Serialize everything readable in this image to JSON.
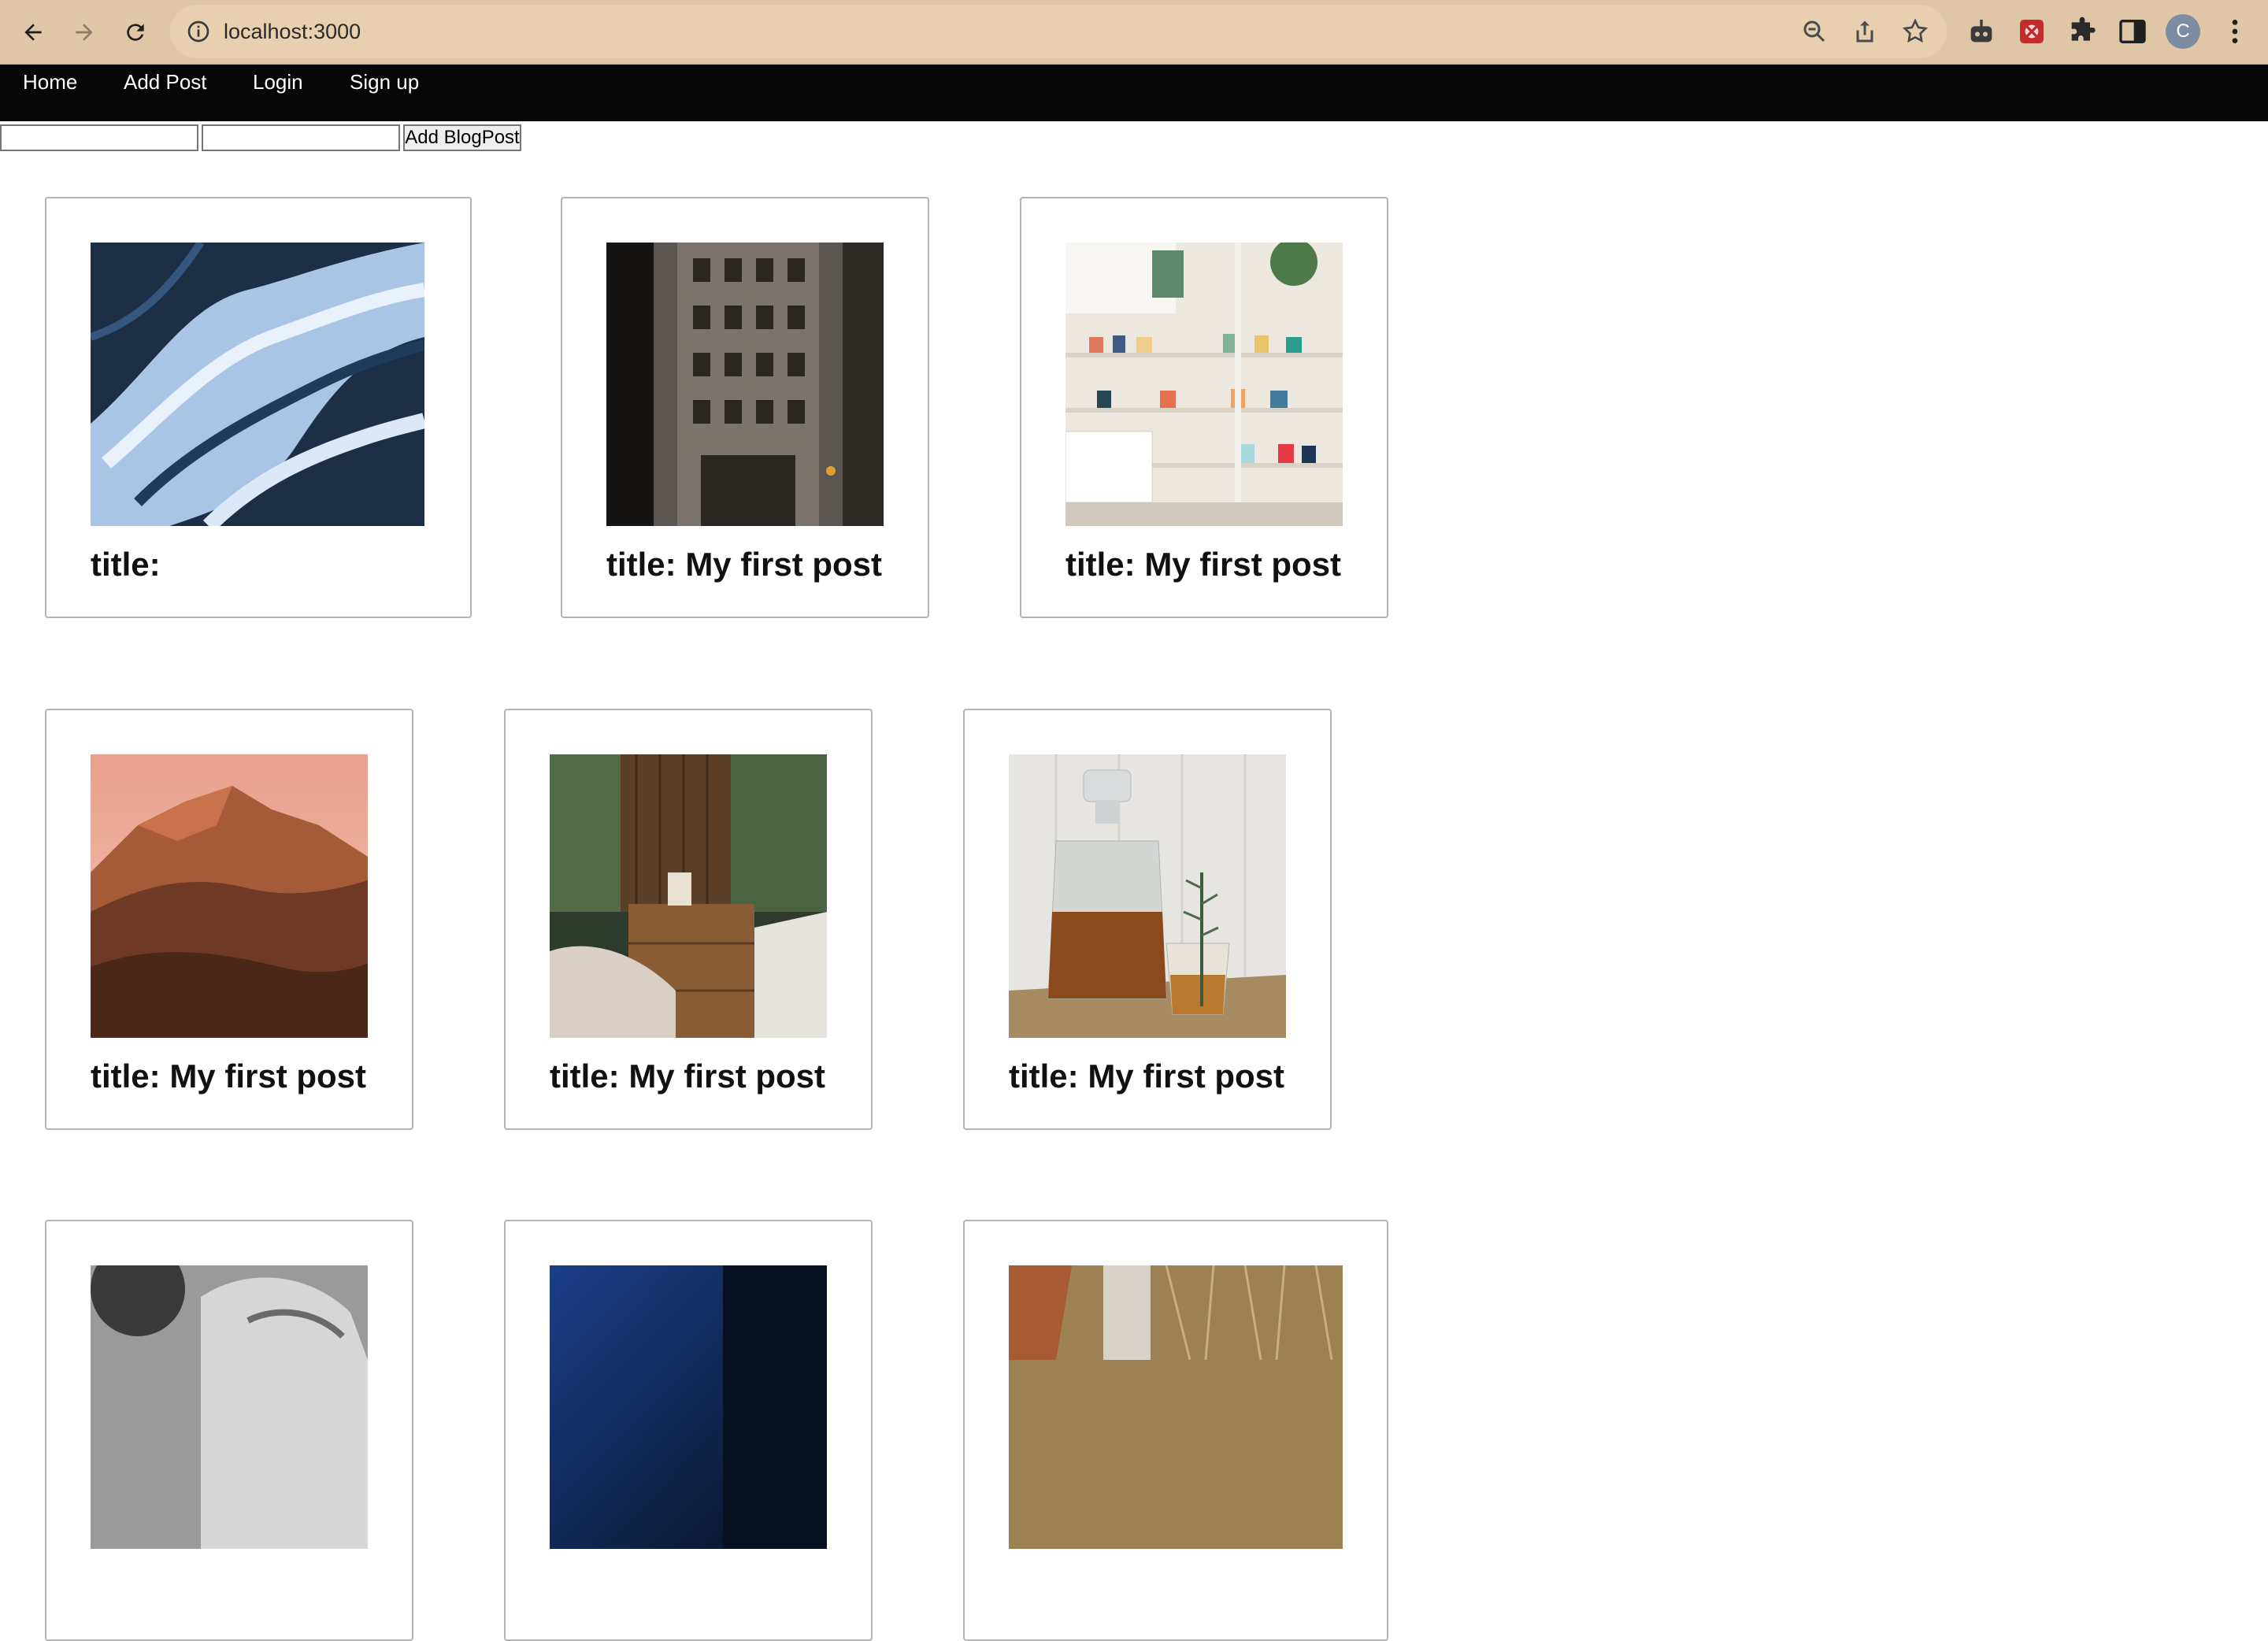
{
  "browser": {
    "url": "localhost:3000",
    "profile_initial": "C"
  },
  "nav": {
    "items": [
      "Home",
      "Add Post",
      "Login",
      "Sign up"
    ]
  },
  "form": {
    "title_value": "",
    "image_value": "",
    "submit_label": "Add BlogPost"
  },
  "posts": [
    {
      "title": "title:",
      "image": "blue-marble-abstract"
    },
    {
      "title": "title: My first post",
      "image": "ornate-building"
    },
    {
      "title": "title: My first post",
      "image": "bookstore-shelves"
    },
    {
      "title": "title: My first post",
      "image": "red-mountain-sunset"
    },
    {
      "title": "title: My first post",
      "image": "bedroom-nightstand"
    },
    {
      "title": "title: My first post",
      "image": "whiskey-decanter"
    },
    {
      "title": "",
      "image": "bw-portrait"
    },
    {
      "title": "",
      "image": "dark-blue-scene"
    },
    {
      "title": "",
      "image": "dry-grass-figure"
    }
  ]
}
